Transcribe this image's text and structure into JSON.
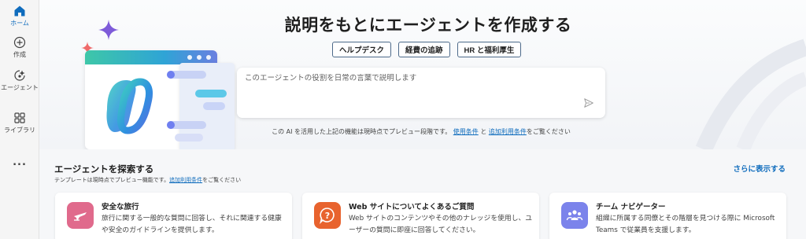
{
  "rail": {
    "items": [
      {
        "label": "ホーム",
        "icon": "home-icon",
        "active": true
      },
      {
        "label": "作成",
        "icon": "plus-circle-icon"
      },
      {
        "label": "エージェント",
        "icon": "agent-icon"
      },
      {
        "label": "ライブラリ",
        "icon": "library-icon"
      },
      {
        "label": "...",
        "icon": "more-icon"
      }
    ]
  },
  "hero": {
    "title": "説明をもとにエージェントを作成する",
    "chips": [
      "ヘルプデスク",
      "経費の追跡",
      "HR と福利厚生"
    ],
    "prompt_placeholder": "このエージェントの役割を日常の言葉で説明します",
    "disclaimer_prefix": "この AI を活用した上記の機能は現時点でプレビュー段階です。",
    "disclaimer_link1": "使用条件",
    "disclaimer_mid": "と",
    "disclaimer_link2": "追加利用条件",
    "disclaimer_suffix": "をご覧ください"
  },
  "explore": {
    "title": "エージェントを探索する",
    "subtitle_prefix": "テンプレートは現時点でプレビュー機能です。",
    "subtitle_link": "追加利用条件",
    "subtitle_suffix": "をご覧ください",
    "see_more": "さらに表示する",
    "cards": [
      {
        "title": "安全な旅行",
        "desc": "旅行に関する一般的な質問に回答し、それに関連する健康や安全のガイドラインを提供します。",
        "icon": "airplane-icon",
        "color": "#e06a8c"
      },
      {
        "title": "Web サイトについてよくあるご質問",
        "desc": "Web サイトのコンテンツやその他のナレッジを使用し、ユーザーの質問に即座に回答してください。",
        "icon": "question-bubble-icon",
        "color": "#e8632e"
      },
      {
        "title": "チーム ナビゲーター",
        "desc": "組織に所属する同僚とその階層を見つける際に Microsoft Teams で従業員を支援します。",
        "icon": "people-icon",
        "color": "#7b83eb"
      }
    ]
  },
  "colors": {
    "accent": "#0f6cbd",
    "chip_border": "#4d6a8a"
  }
}
